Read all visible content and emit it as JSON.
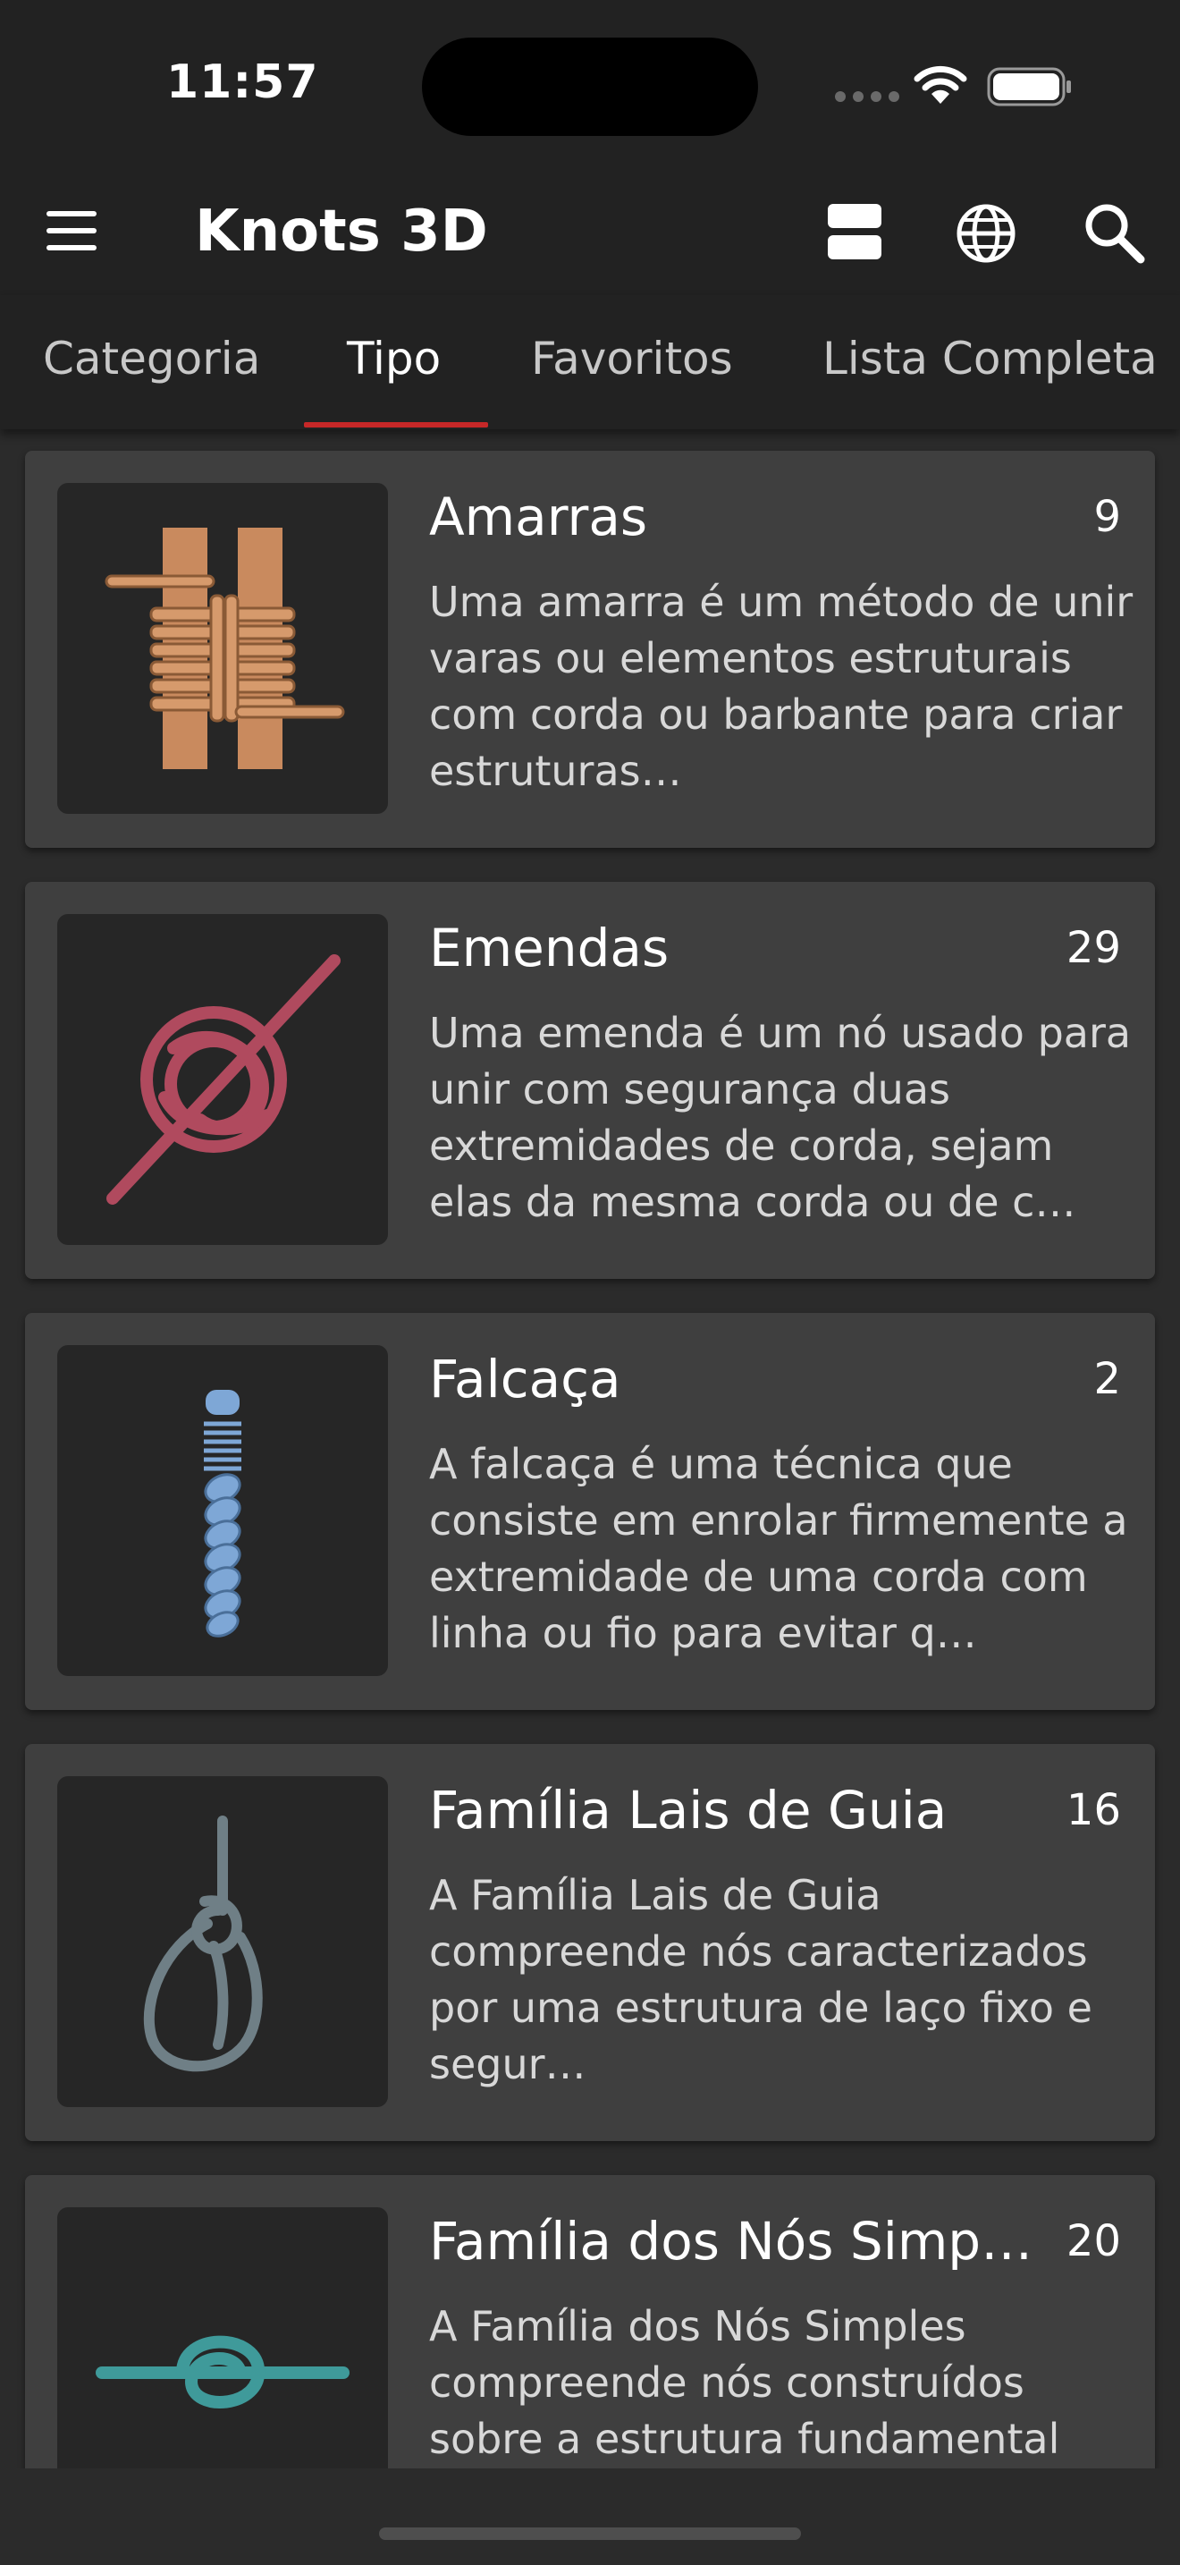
{
  "status_bar": {
    "time": "11:57"
  },
  "app_bar": {
    "title": "Knots 3D",
    "icons": [
      "menu-icon",
      "view-toggle-icon",
      "globe-icon",
      "search-icon"
    ]
  },
  "tabs": [
    {
      "label": "Categoria",
      "active": false
    },
    {
      "label": "Tipo",
      "active": true
    },
    {
      "label": "Favoritos",
      "active": false
    },
    {
      "label": "Lista Completa",
      "active": false
    }
  ],
  "colors": {
    "background": "#2b2b2b",
    "bar": "#222222",
    "card": "#3f3f3f",
    "tab_indicator": "#c62828",
    "lashing_brown": "#c98a5e",
    "bend_red": "#b04a5e",
    "whipping_blue": "#7ea7d6",
    "bowline_gray": "#6f7f86",
    "overhand_teal": "#3f9a9a"
  },
  "items": [
    {
      "title": "Amarras",
      "count": "9",
      "description": "Uma amarra é um método de unir varas ou elementos estruturais com corda ou barbante para criar estruturas…",
      "icon": "lashing-icon"
    },
    {
      "title": "Emendas",
      "count": "29",
      "description": "Uma emenda é um nó usado para unir com segurança duas extremidades de corda, sejam elas da mesma corda ou de c…",
      "icon": "bend-knot-icon"
    },
    {
      "title": "Falcaça",
      "count": "2",
      "description": "A falcaça é uma técnica que consiste em enrolar firmemente a extremidade de uma corda com linha ou fio para evitar q…",
      "icon": "whipping-icon"
    },
    {
      "title": "Família Lais de Guia",
      "count": "16",
      "description": "A Família Lais de Guia compreende nós caracterizados por uma estrutura de laço fixo e segur…",
      "icon": "bowline-icon"
    },
    {
      "title": "Família dos Nós Simpl…",
      "count": "20",
      "description": "A Família dos Nós Simples compreende nós construídos sobre a estrutura fundamental",
      "icon": "overhand-knot-icon"
    }
  ]
}
